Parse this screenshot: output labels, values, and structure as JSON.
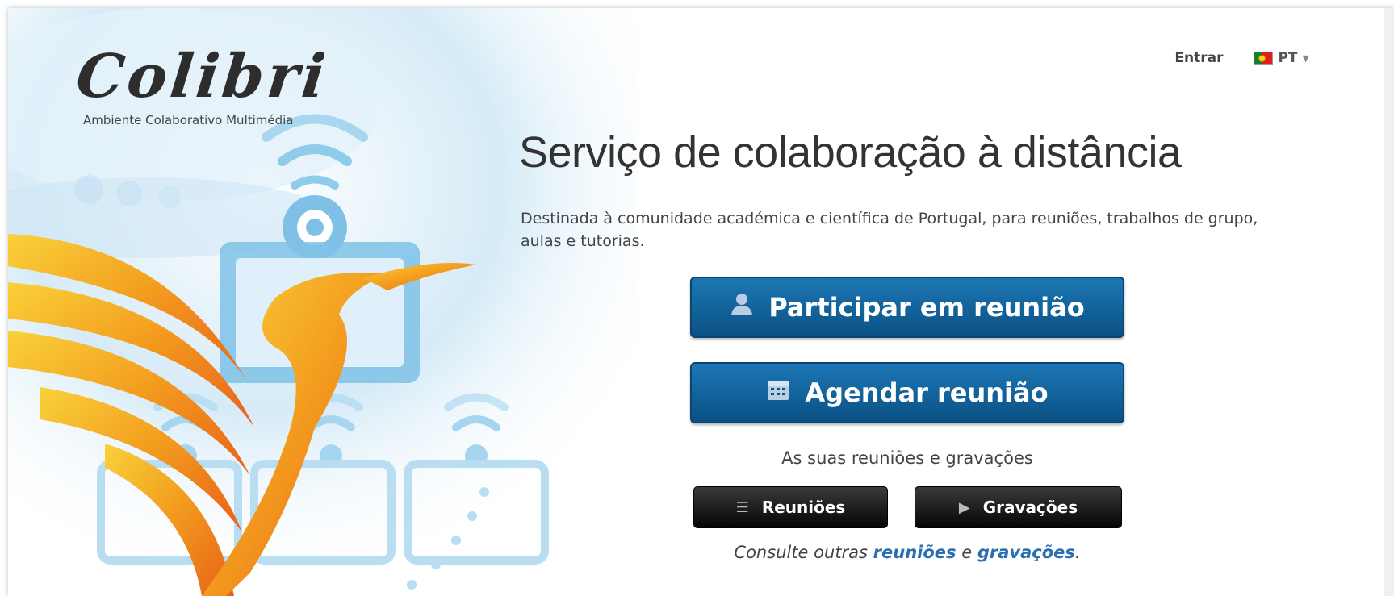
{
  "brand": {
    "logo_text": "Colibri",
    "tagline": "Ambiente Colaborativo Multimédia"
  },
  "nav": {
    "login_label": "Entrar",
    "language_label": "PT",
    "language_flag_icon": "portugal-flag-icon"
  },
  "hero": {
    "title": "Serviço de colaboração à distância",
    "description": "Destinada à comunidade académica e científica de Portugal, para reuniões, trabalhos de grupo, aulas e tutorias."
  },
  "actions": {
    "join_label": "Participar em reunião",
    "join_icon": "user-icon",
    "schedule_label": "Agendar reunião",
    "schedule_icon": "calendar-icon"
  },
  "your_section": {
    "heading": "As suas reuniões e gravações",
    "meetings_label": "Reuniões",
    "meetings_icon": "list-icon",
    "recordings_label": "Gravações",
    "recordings_icon": "play-icon"
  },
  "footer_note": {
    "prefix": "Consulte outras ",
    "meetings_link": "reuniões",
    "connector": " e ",
    "recordings_link": "gravações",
    "suffix": "."
  },
  "colors": {
    "primary_button": "#0a5184",
    "dark_button": "#111111",
    "link": "#2a6fb0",
    "art_orange": "#f28a1a",
    "art_blue": "#8ec8ea"
  }
}
